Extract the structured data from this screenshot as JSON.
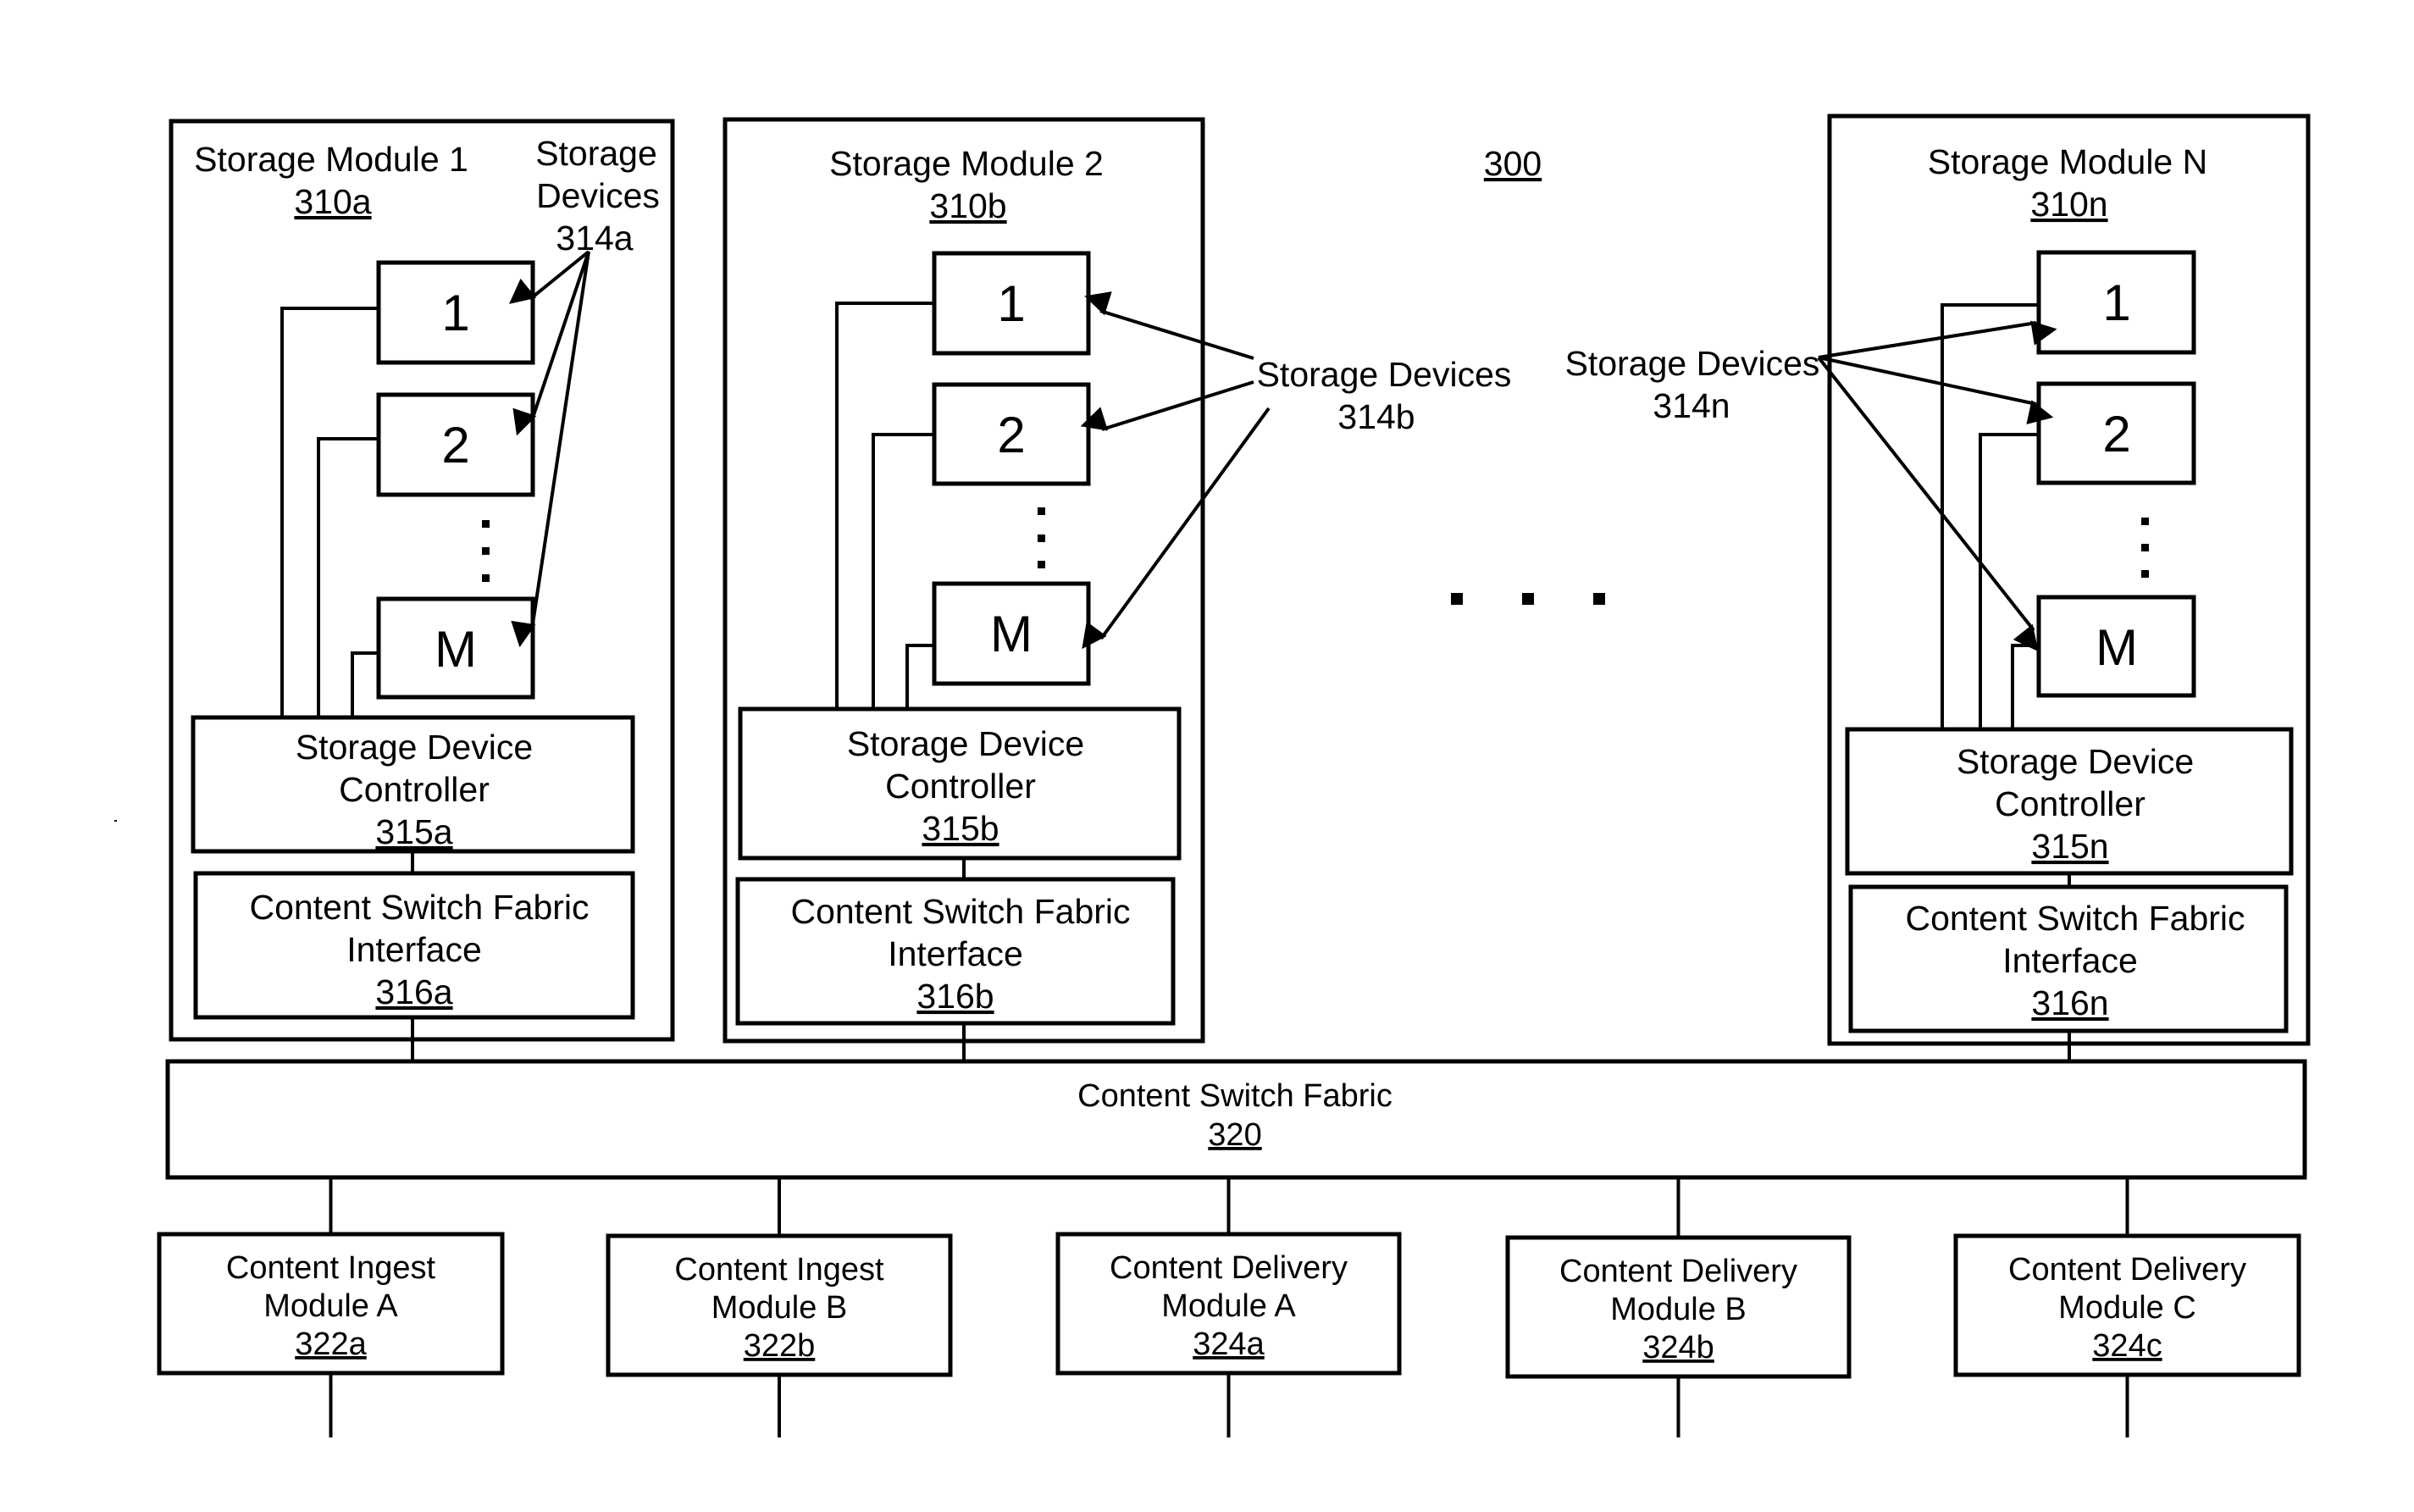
{
  "figure": {
    "reference": "300",
    "ellipsis": "· · ·"
  },
  "storage_modules": [
    {
      "title": "Storage Module 1",
      "ref": "310a",
      "devices": [
        "1",
        "2",
        "M"
      ],
      "devices_label": [
        "Storage",
        "Devices",
        "314a"
      ],
      "controller": {
        "lines": [
          "Storage Device",
          "Controller"
        ],
        "ref": "315a"
      },
      "interface": {
        "lines": [
          "Content Switch Fabric",
          "Interface"
        ],
        "ref": "316a"
      }
    },
    {
      "title": "Storage Module 2",
      "ref": "310b",
      "devices": [
        "1",
        "2",
        "M"
      ],
      "devices_label": [
        "Storage Devices",
        "314b"
      ],
      "controller": {
        "lines": [
          "Storage Device",
          "Controller"
        ],
        "ref": "315b"
      },
      "interface": {
        "lines": [
          "Content Switch Fabric",
          "Interface"
        ],
        "ref": "316b"
      }
    },
    {
      "title": "Storage Module N",
      "ref": "310n",
      "devices": [
        "1",
        "2",
        "M"
      ],
      "devices_label": [
        "Storage Devices",
        "314n"
      ],
      "controller": {
        "lines": [
          "Storage Device",
          "Controller"
        ],
        "ref": "315n"
      },
      "interface": {
        "lines": [
          "Content Switch Fabric",
          "Interface"
        ],
        "ref": "316n"
      }
    }
  ],
  "fabric": {
    "label": "Content Switch Fabric",
    "ref": "320"
  },
  "edge_modules": [
    {
      "lines": [
        "Content Ingest",
        "Module A"
      ],
      "ref": "322a"
    },
    {
      "lines": [
        "Content Ingest",
        "Module B"
      ],
      "ref": "322b"
    },
    {
      "lines": [
        "Content Delivery",
        "Module A"
      ],
      "ref": "324a"
    },
    {
      "lines": [
        "Content Delivery",
        "Module B"
      ],
      "ref": "324b"
    },
    {
      "lines": [
        "Content Delivery",
        "Module C"
      ],
      "ref": "324c"
    }
  ]
}
